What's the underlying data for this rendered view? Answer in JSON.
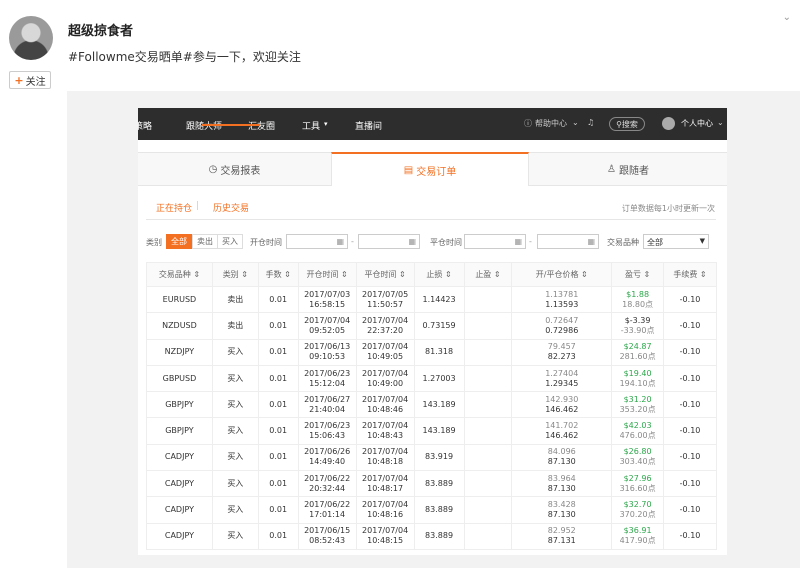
{
  "post": {
    "username": "超级掠食者",
    "text": "#Followme交易晒单#参与一下，欢迎关注",
    "follow_label": "关注",
    "corner_icon": "⌄"
  },
  "nav": {
    "items": [
      "策略",
      "跟随大师",
      "汇友圈",
      "工具",
      "直播间"
    ],
    "help": "帮助中心",
    "search": "搜索",
    "user": "个人中心"
  },
  "tabs": [
    {
      "label": "交易报表",
      "icon": "◷"
    },
    {
      "label": "交易订单",
      "icon": "▤"
    },
    {
      "label": "跟随者",
      "icon": "♙"
    }
  ],
  "subtabs": [
    "正在持仓",
    "历史交易"
  ],
  "update_note": "订单数据每1小时更新一次",
  "filters": {
    "type_label": "类别",
    "segments": [
      "全部",
      "卖出",
      "买入"
    ],
    "open_time_label": "开仓时间",
    "close_time_label": "平仓时间",
    "symbol_label": "交易品种",
    "symbol_value": "全部"
  },
  "table": {
    "headers": [
      "交易品种",
      "类别",
      "手数",
      "开仓时间",
      "平仓时间",
      "止损",
      "止盈",
      "开/平仓价格",
      "盈亏",
      "手续费"
    ],
    "rows": [
      {
        "symbol": "EURUSD",
        "type": "卖出",
        "side": "sell",
        "lots": "0.01",
        "open_d": "2017/07/03",
        "open_t": "16:58:15",
        "close_d": "2017/07/05",
        "close_t": "11:50:57",
        "sl": "1.14423",
        "tp": "",
        "p_open": "1.13781",
        "p_close": "1.13593",
        "profit": "$1.88",
        "pips": "18.80点",
        "fee": "-0.10"
      },
      {
        "symbol": "NZDUSD",
        "type": "卖出",
        "side": "sell",
        "lots": "0.01",
        "open_d": "2017/07/04",
        "open_t": "09:52:05",
        "close_d": "2017/07/04",
        "close_t": "22:37:20",
        "sl": "0.73159",
        "tp": "",
        "p_open": "0.72647",
        "p_close": "0.72986",
        "profit": "$-3.39",
        "pips": "-33.90点",
        "fee": "-0.10"
      },
      {
        "symbol": "NZDJPY",
        "type": "买入",
        "side": "buy",
        "lots": "0.01",
        "open_d": "2017/06/13",
        "open_t": "09:10:53",
        "close_d": "2017/07/04",
        "close_t": "10:49:05",
        "sl": "81.318",
        "tp": "",
        "p_open": "79.457",
        "p_close": "82.273",
        "profit": "$24.87",
        "pips": "281.60点",
        "fee": "-0.10"
      },
      {
        "symbol": "GBPUSD",
        "type": "买入",
        "side": "buy",
        "lots": "0.01",
        "open_d": "2017/06/23",
        "open_t": "15:12:04",
        "close_d": "2017/07/04",
        "close_t": "10:49:00",
        "sl": "1.27003",
        "tp": "",
        "p_open": "1.27404",
        "p_close": "1.29345",
        "profit": "$19.40",
        "pips": "194.10点",
        "fee": "-0.10"
      },
      {
        "symbol": "GBPJPY",
        "type": "买入",
        "side": "buy",
        "lots": "0.01",
        "open_d": "2017/06/27",
        "open_t": "21:40:04",
        "close_d": "2017/07/04",
        "close_t": "10:48:46",
        "sl": "143.189",
        "tp": "",
        "p_open": "142.930",
        "p_close": "146.462",
        "profit": "$31.20",
        "pips": "353.20点",
        "fee": "-0.10"
      },
      {
        "symbol": "GBPJPY",
        "type": "买入",
        "side": "buy",
        "lots": "0.01",
        "open_d": "2017/06/23",
        "open_t": "15:06:43",
        "close_d": "2017/07/04",
        "close_t": "10:48:43",
        "sl": "143.189",
        "tp": "",
        "p_open": "141.702",
        "p_close": "146.462",
        "profit": "$42.03",
        "pips": "476.00点",
        "fee": "-0.10"
      },
      {
        "symbol": "CADJPY",
        "type": "买入",
        "side": "buy",
        "lots": "0.01",
        "open_d": "2017/06/26",
        "open_t": "14:49:40",
        "close_d": "2017/07/04",
        "close_t": "10:48:18",
        "sl": "83.919",
        "tp": "",
        "p_open": "84.096",
        "p_close": "87.130",
        "profit": "$26.80",
        "pips": "303.40点",
        "fee": "-0.10"
      },
      {
        "symbol": "CADJPY",
        "type": "买入",
        "side": "buy",
        "lots": "0.01",
        "open_d": "2017/06/22",
        "open_t": "20:32:44",
        "close_d": "2017/07/04",
        "close_t": "10:48:17",
        "sl": "83.889",
        "tp": "",
        "p_open": "83.964",
        "p_close": "87.130",
        "profit": "$27.96",
        "pips": "316.60点",
        "fee": "-0.10"
      },
      {
        "symbol": "CADJPY",
        "type": "买入",
        "side": "buy",
        "lots": "0.01",
        "open_d": "2017/06/22",
        "open_t": "17:01:14",
        "close_d": "2017/07/04",
        "close_t": "10:48:16",
        "sl": "83.889",
        "tp": "",
        "p_open": "83.428",
        "p_close": "87.130",
        "profit": "$32.70",
        "pips": "370.20点",
        "fee": "-0.10"
      },
      {
        "symbol": "CADJPY",
        "type": "买入",
        "side": "buy",
        "lots": "0.01",
        "open_d": "2017/06/15",
        "open_t": "08:52:43",
        "close_d": "2017/07/04",
        "close_t": "10:48:15",
        "sl": "83.889",
        "tp": "",
        "p_open": "82.952",
        "p_close": "87.131",
        "profit": "$36.91",
        "pips": "417.90点",
        "fee": "-0.10"
      }
    ]
  },
  "colors": {
    "accent": "#f36f21",
    "sell": "#e5342a",
    "buy": "#2ca84b",
    "nav_bg": "#2d2d2d"
  }
}
